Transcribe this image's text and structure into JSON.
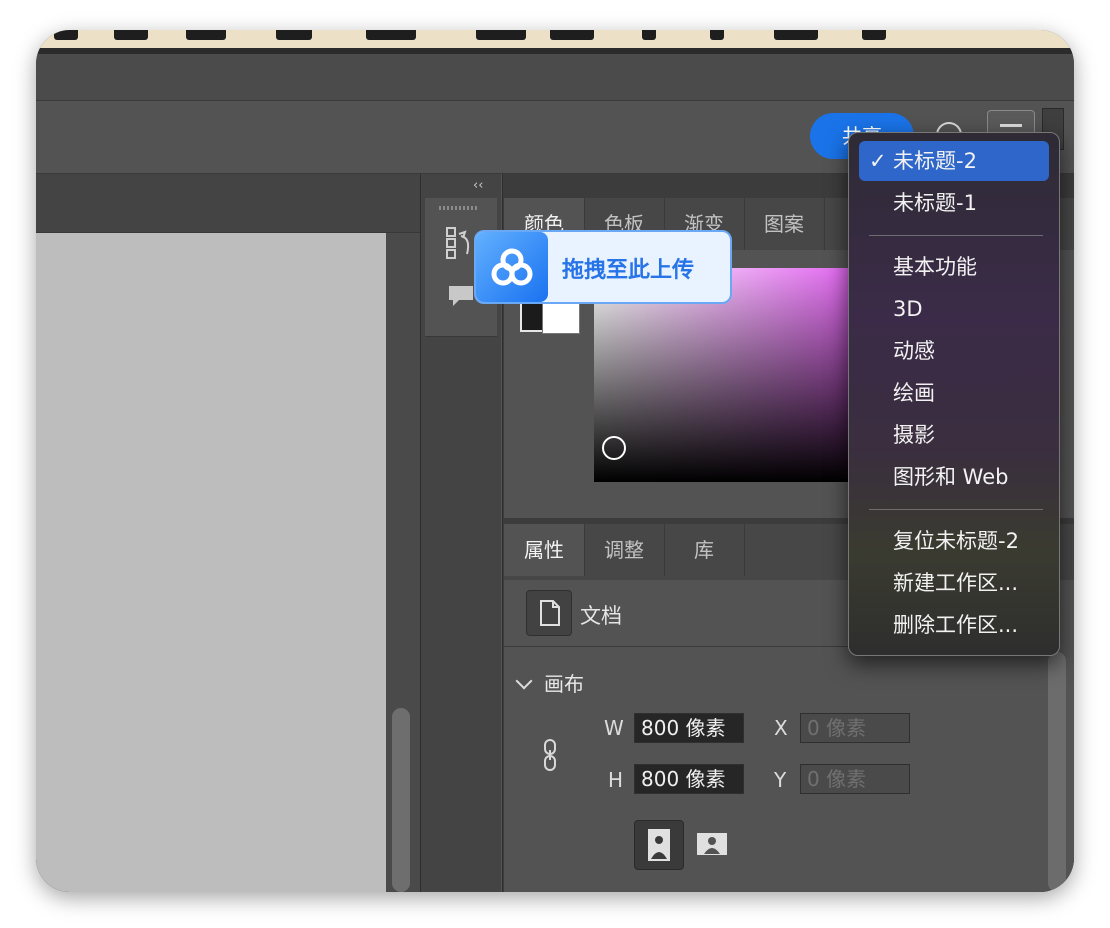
{
  "header": {
    "share_label": "共享"
  },
  "color_panel": {
    "tabs": [
      {
        "label": "颜色",
        "active": true
      },
      {
        "label": "色板",
        "active": false
      },
      {
        "label": "渐变",
        "active": false
      },
      {
        "label": "图案",
        "active": false
      }
    ],
    "accent_hue": "#e060ef"
  },
  "upload_overlay": {
    "label": "拖拽至此上传",
    "accent": "#2773e8"
  },
  "workspace_menu": {
    "items": [
      {
        "label": "未标题-2",
        "checked": true
      },
      {
        "label": "未标题-1"
      },
      {
        "label": "基本功能"
      },
      {
        "label": "3D"
      },
      {
        "label": "动感"
      },
      {
        "label": "绘画"
      },
      {
        "label": "摄影"
      },
      {
        "label": "图形和 Web"
      },
      {
        "label": "复位未标题-2"
      },
      {
        "label": "新建工作区..."
      },
      {
        "label": "删除工作区..."
      }
    ],
    "check_glyph": "✓",
    "highlight_color": "#2f66c9"
  },
  "properties_panel": {
    "tabs": [
      {
        "label": "属性",
        "active": true
      },
      {
        "label": "调整",
        "active": false
      },
      {
        "label": "库",
        "active": false
      }
    ],
    "doc_label": "文档",
    "canvas_section": "画布",
    "w_label": "W",
    "w_value": "800 像素",
    "h_label": "H",
    "h_value": "800 像素",
    "x_label": "X",
    "x_placeholder": "0 像素",
    "y_label": "Y",
    "y_placeholder": "0 像素"
  },
  "toolstrip": {
    "collapse_glyph": "‹‹"
  }
}
